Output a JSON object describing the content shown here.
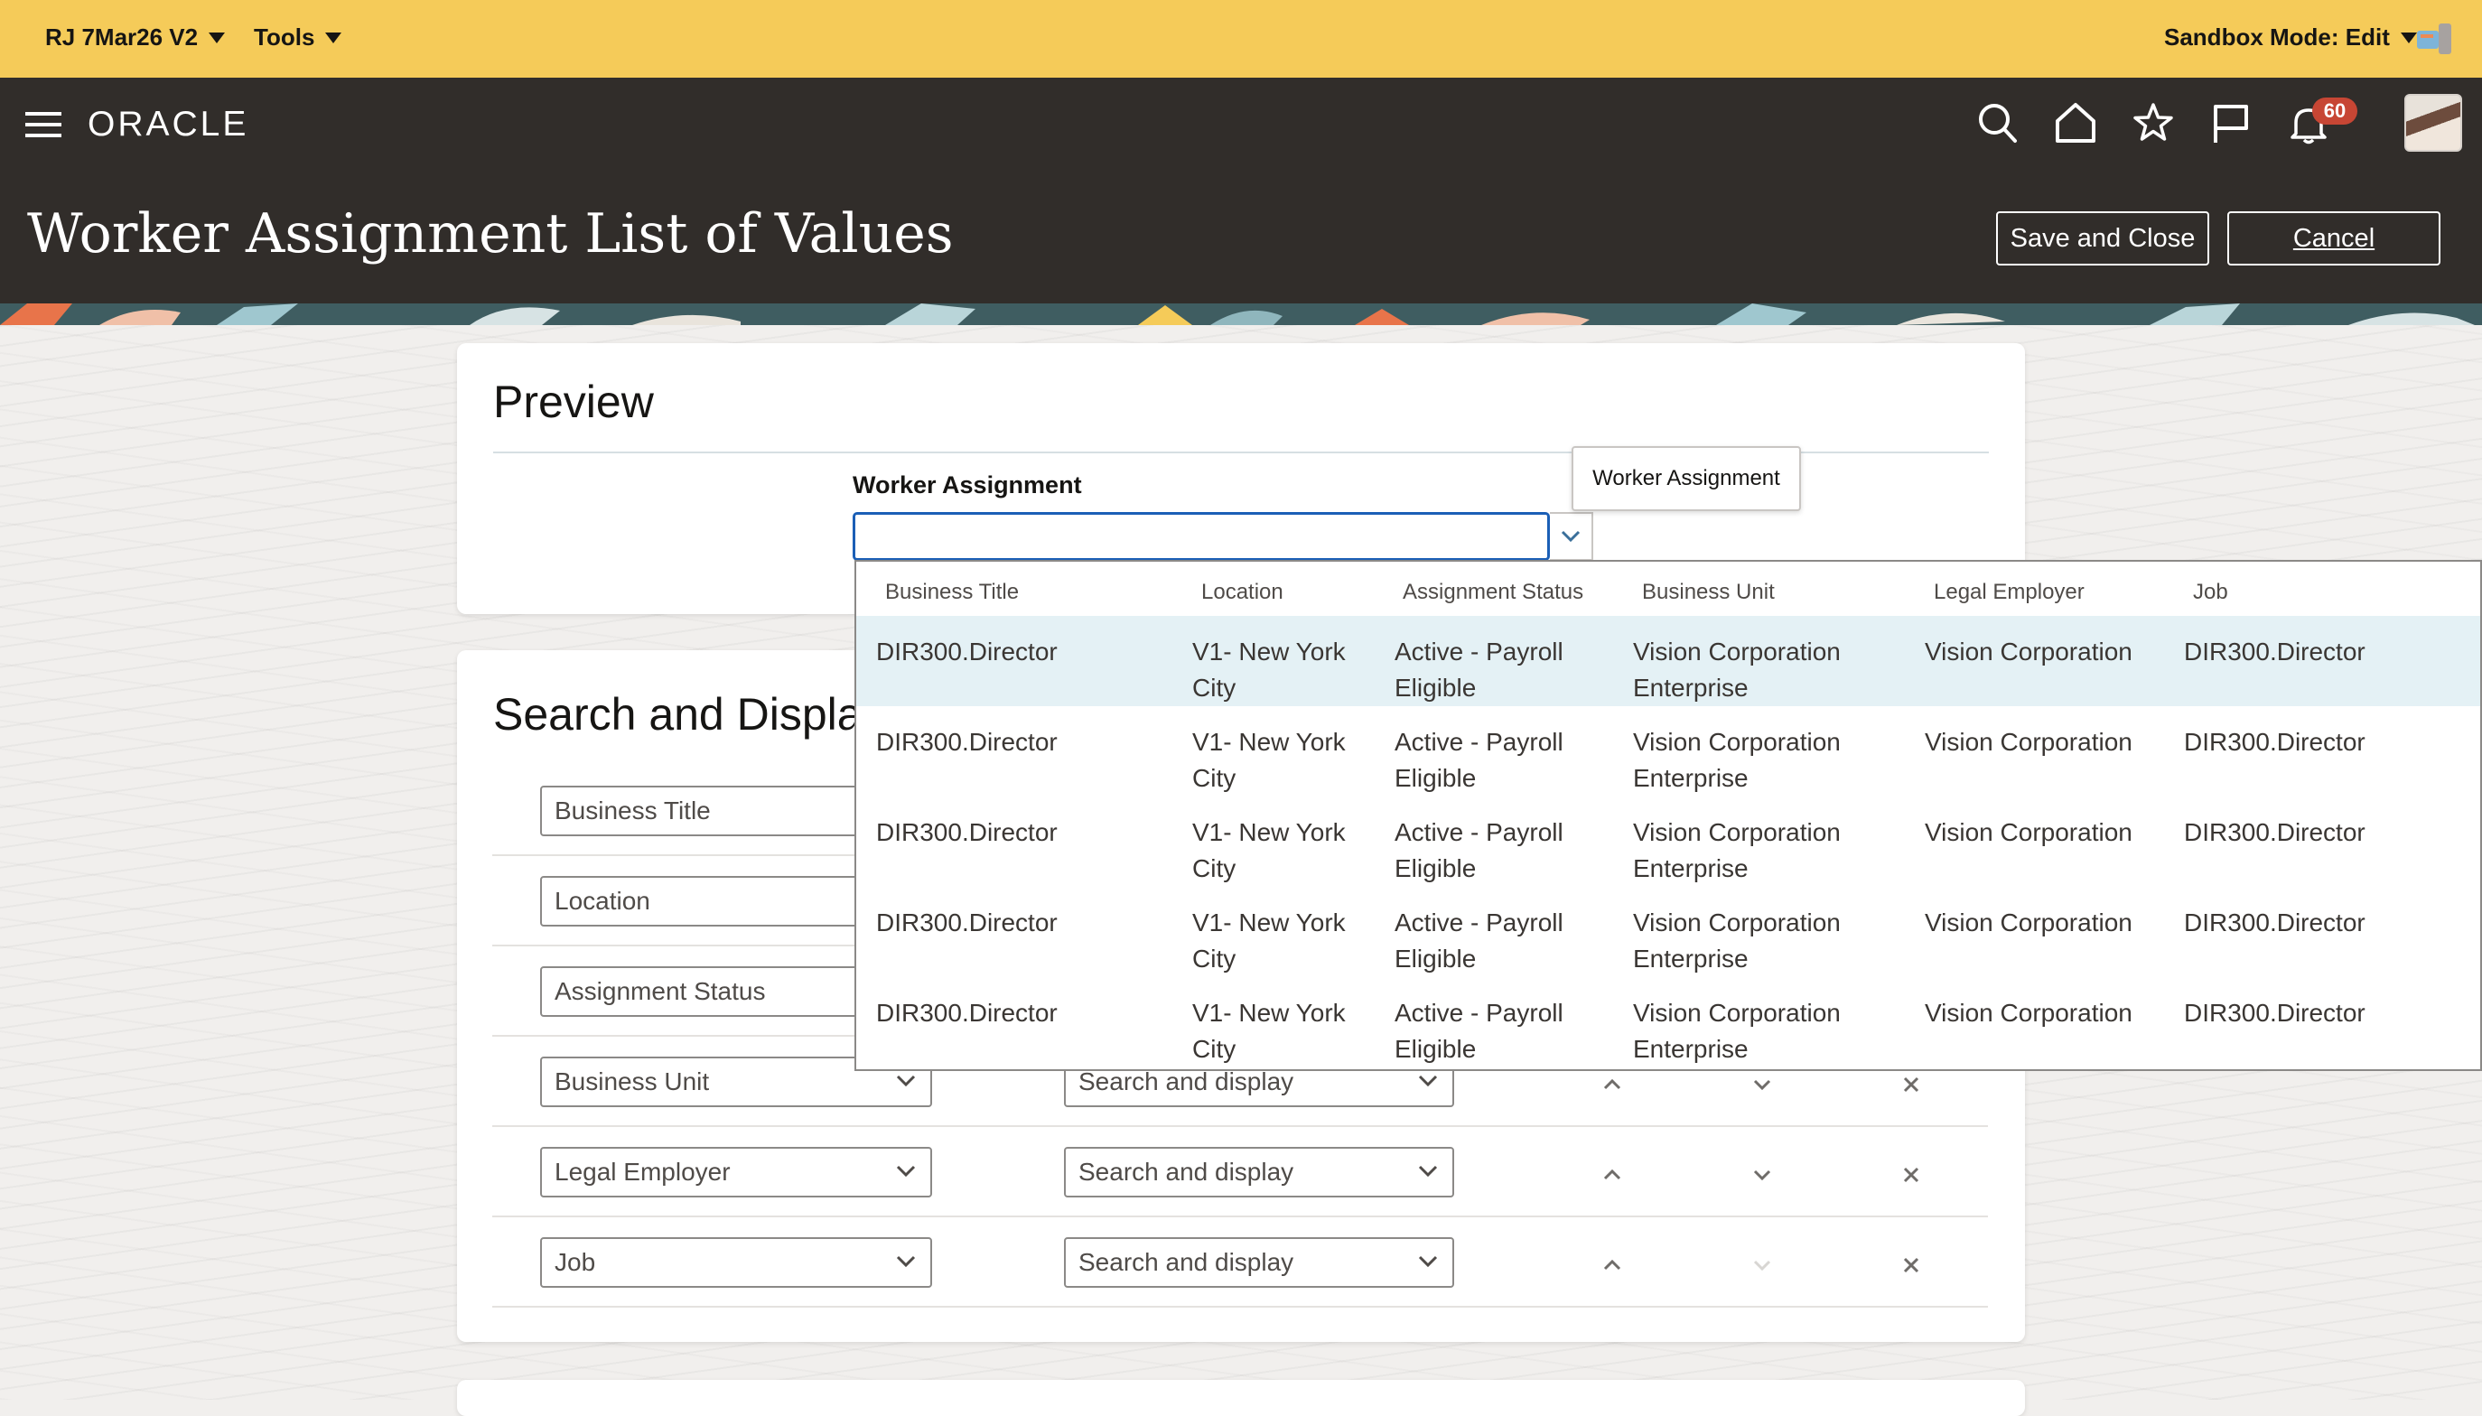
{
  "sandbox_bar": {
    "sandbox_name": "RJ 7Mar26 V2",
    "tools_label": "Tools",
    "mode_label": "Sandbox Mode: Edit"
  },
  "header": {
    "logo_text": "ORACLE",
    "notification_count": "60",
    "page_title": "Worker Assignment List of Values",
    "save_close_label": "Save and Close",
    "cancel_label": "Cancel"
  },
  "preview": {
    "title": "Preview",
    "field_label": "Worker Assignment",
    "field_value": "",
    "tooltip": "Worker Assignment"
  },
  "search_display": {
    "title": "Search and Displa",
    "rows": [
      {
        "attribute": "Business Title",
        "mode": ""
      },
      {
        "attribute": "Location",
        "mode": ""
      },
      {
        "attribute": "Assignment Status",
        "mode": ""
      },
      {
        "attribute": "Business Unit",
        "mode": "Search and display"
      },
      {
        "attribute": "Legal Employer",
        "mode": "Search and display"
      },
      {
        "attribute": "Job",
        "mode": "Search and display"
      }
    ]
  },
  "lov_table": {
    "columns": [
      "Business Title",
      "Location",
      "Assignment Status",
      "Business Unit",
      "Legal Employer",
      "Job"
    ],
    "rows": [
      {
        "business_title": "DIR300.Director",
        "location": "V1- New York City",
        "assignment_status": "Active - Payroll Eligible",
        "business_unit": "Vision Corporation Enterprise",
        "legal_employer": "Vision Corporation",
        "job": "DIR300.Director"
      },
      {
        "business_title": "DIR300.Director",
        "location": "V1- New York City",
        "assignment_status": "Active - Payroll Eligible",
        "business_unit": "Vision Corporation Enterprise",
        "legal_employer": "Vision Corporation",
        "job": "DIR300.Director"
      },
      {
        "business_title": "DIR300.Director",
        "location": "V1- New York City",
        "assignment_status": "Active - Payroll Eligible",
        "business_unit": "Vision Corporation Enterprise",
        "legal_employer": "Vision Corporation",
        "job": "DIR300.Director"
      },
      {
        "business_title": "DIR300.Director",
        "location": "V1- New York City",
        "assignment_status": "Active - Payroll Eligible",
        "business_unit": "Vision Corporation Enterprise",
        "legal_employer": "Vision Corporation",
        "job": "DIR300.Director"
      },
      {
        "business_title": "DIR300.Director",
        "location": "V1- New York City",
        "assignment_status": "Active - Payroll Eligible",
        "business_unit": "Vision Corporation Enterprise",
        "legal_employer": "Vision Corporation",
        "job": "DIR300.Director"
      }
    ]
  },
  "colors": {
    "sandbox_bar": "#f5cb59",
    "header": "#312d2a",
    "focus_border": "#1b5fb6",
    "selected_row": "#e4f1f5",
    "badge": "#c74634"
  }
}
